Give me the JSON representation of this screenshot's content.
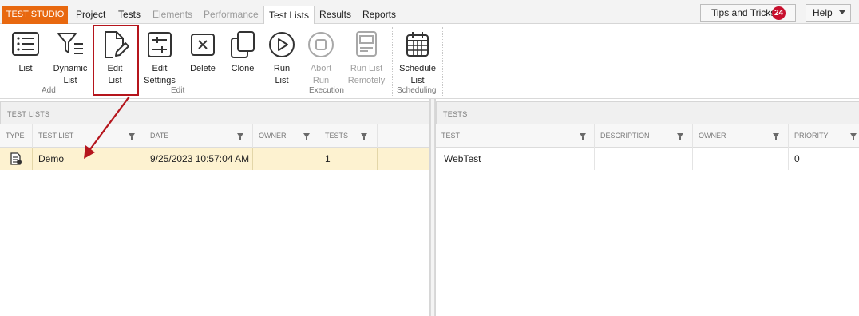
{
  "menubar": {
    "brand": "TEST STUDIO",
    "tabs": [
      {
        "label": "Project",
        "state": "normal"
      },
      {
        "label": "Tests",
        "state": "normal"
      },
      {
        "label": "Elements",
        "state": "disabled"
      },
      {
        "label": "Performance",
        "state": "disabled"
      },
      {
        "label": "Test Lists",
        "state": "active"
      },
      {
        "label": "Results",
        "state": "normal"
      },
      {
        "label": "Reports",
        "state": "normal"
      }
    ],
    "tips_label": "Tips and Tricks",
    "tips_count": "24",
    "help_label": "Help"
  },
  "ribbon": {
    "buttons": {
      "list": {
        "line1": "List",
        "line2": ""
      },
      "dynamic_list": {
        "line1": "Dynamic",
        "line2": "List"
      },
      "edit_list": {
        "line1": "Edit",
        "line2": "List"
      },
      "edit_settings": {
        "line1": "Edit",
        "line2": "Settings"
      },
      "delete": {
        "line1": "Delete",
        "line2": ""
      },
      "clone": {
        "line1": "Clone",
        "line2": ""
      },
      "run_list": {
        "line1": "Run",
        "line2": "List"
      },
      "abort_run": {
        "line1": "Abort",
        "line2": "Run"
      },
      "run_list_remotely": {
        "line1": "Run List",
        "line2": "Remotely"
      },
      "schedule_list": {
        "line1": "Schedule",
        "line2": "List"
      }
    },
    "groups": {
      "add": "Add",
      "edit": "Edit",
      "execution": "Execution",
      "scheduling": "Scheduling"
    }
  },
  "test_lists_panel": {
    "title": "TEST LISTS",
    "columns": [
      "TYPE",
      "TEST LIST",
      "DATE",
      "OWNER",
      "TESTS"
    ],
    "rows": [
      {
        "name": "Demo",
        "date": "9/25/2023 10:57:04 AM",
        "owner": "",
        "tests": "1"
      }
    ]
  },
  "tests_panel": {
    "title": "TESTS",
    "columns": [
      "TEST",
      "DESCRIPTION",
      "OWNER",
      "PRIORITY"
    ],
    "rows": [
      {
        "test": "WebTest",
        "description": "",
        "owner": "",
        "priority": "0"
      }
    ]
  },
  "colors": {
    "brand": "#e8680f",
    "highlight": "#b5151c",
    "selected_row": "#fdf2d0",
    "badge": "#c8102e"
  }
}
